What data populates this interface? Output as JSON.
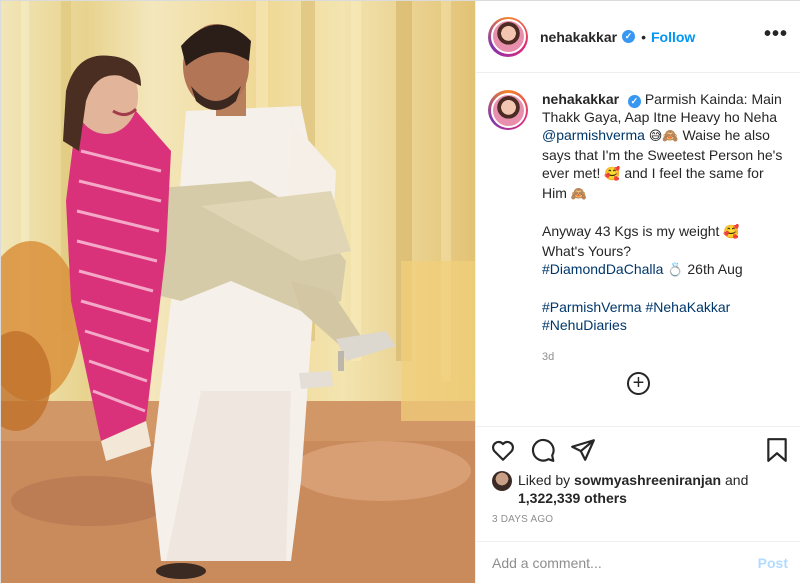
{
  "post": {
    "username": "nehakakkar",
    "verified": true,
    "follow_label": "Follow",
    "header_separator": "•",
    "more_label": "•••"
  },
  "caption": {
    "lines": [
      "Parmish Kainda: Main Thakk Gaya, Aap Itne Heavy ho Neha",
      "@parmishverma",
      "😅🙈",
      "Waise he also says that I'm the Sweetest Person he's ever met!",
      "🥰",
      "and I feel the same for Him",
      "🙈",
      "Anyway 43 Kgs is my weight",
      "🥰",
      "What's Yours?",
      "#DiamondDaChalla",
      "💍",
      "26th Aug",
      "#ParmishVerma",
      "#NehaKakkar",
      "#NehuDiaries"
    ],
    "age": "3d"
  },
  "add_icon": "plus-circle-icon",
  "actions": {
    "icons": [
      "heart-icon",
      "comment-icon",
      "share-icon",
      "bookmark-icon"
    ]
  },
  "likes": {
    "prefix": "Liked by",
    "liker": "sowmyashreeniranjan",
    "and": "and",
    "count": "1,322,339 others"
  },
  "timestamp": "3 DAYS AGO",
  "comment": {
    "placeholder": "Add a comment...",
    "post_label": "Post"
  },
  "colors": {
    "accent": "#0095f6",
    "post_disabled": "#b3dbff",
    "link": "#00376b",
    "muted": "#8e8e8e",
    "dupatta": "#d9327a"
  }
}
